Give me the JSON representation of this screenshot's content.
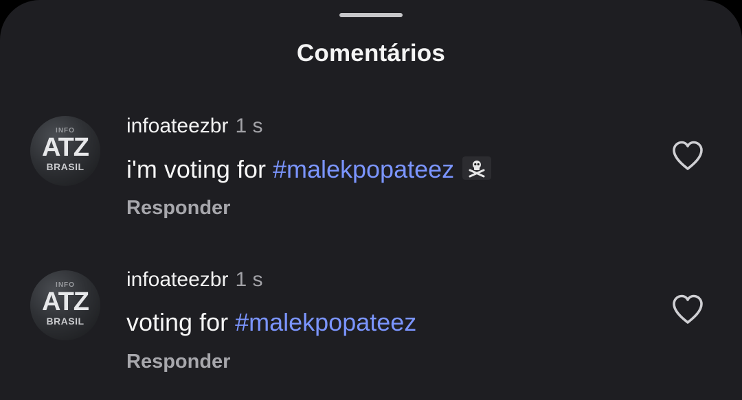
{
  "sheet": {
    "title": "Comentários"
  },
  "comments": [
    {
      "avatar": {
        "line1": "INFO",
        "line2": "ATZ",
        "line3": "BRASIL"
      },
      "username": "infoateezbr",
      "time": "1 s",
      "text_before": "i'm voting for ",
      "hashtag": "#malekpopateez",
      "emoji": "skull-and-crossbones flag",
      "reply_label": "Responder"
    },
    {
      "avatar": {
        "line1": "INFO",
        "line2": "ATZ",
        "line3": "BRASIL"
      },
      "username": "infoateezbr",
      "time": "1 s",
      "text_before": "voting for ",
      "hashtag": "#malekpopateez",
      "reply_label": "Responder"
    }
  ],
  "colors": {
    "background": "#1e1e22",
    "hashtag": "#7b95ff",
    "muted": "#a7a7ac"
  },
  "icons": {
    "like": "heart-outline-icon",
    "emoji": "pirate-flag-icon"
  }
}
